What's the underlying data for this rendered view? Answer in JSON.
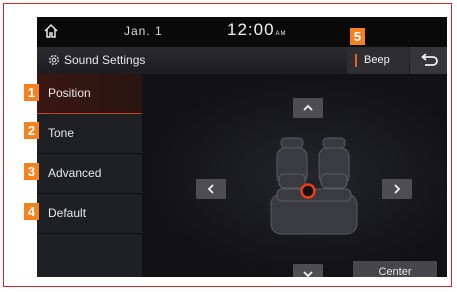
{
  "status": {
    "date": "Jan.  1",
    "time": "12:00",
    "ampm": "AM"
  },
  "title": {
    "text": "Sound Settings"
  },
  "beep": {
    "label": "Beep"
  },
  "sidebar": {
    "items": [
      {
        "label": "Position",
        "marker": "1",
        "active": true
      },
      {
        "label": "Tone",
        "marker": "2"
      },
      {
        "label": "Advanced",
        "marker": "3"
      },
      {
        "label": "Default",
        "marker": "4"
      }
    ]
  },
  "beep_marker": "5",
  "controls": {
    "center_label": "Center"
  },
  "colors": {
    "accent": "#e9611e",
    "marker": "#f58220",
    "focus": "#e53512"
  },
  "icons": [
    "home-icon",
    "gear-icon",
    "back-icon",
    "chevron-up-icon",
    "chevron-down-icon",
    "chevron-left-icon",
    "chevron-right-icon"
  ]
}
